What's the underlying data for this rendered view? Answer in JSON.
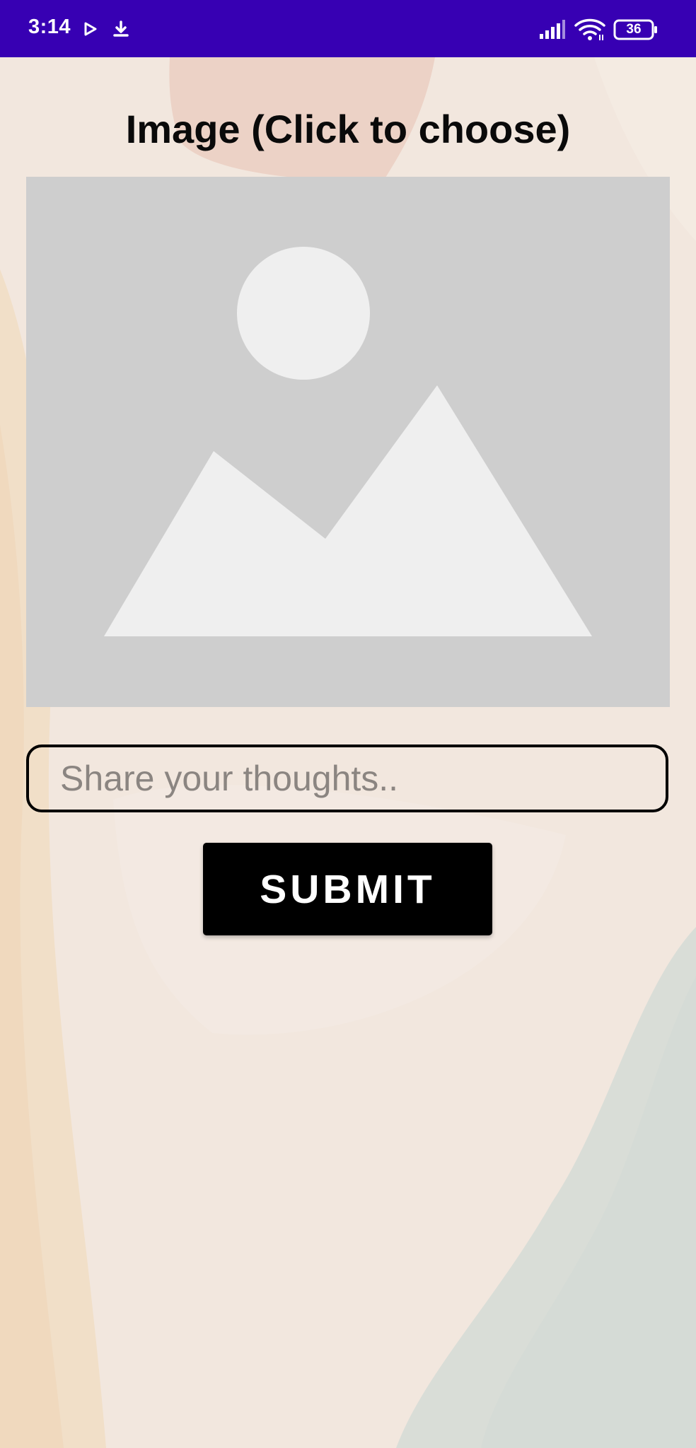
{
  "status_bar": {
    "time": "3:14",
    "battery_level": "36",
    "icons": [
      "play-notification-icon",
      "download-icon",
      "signal-icon",
      "wifi-icon",
      "battery-icon"
    ],
    "background_color": "#3700b3"
  },
  "main": {
    "title": "Image (Click to choose)",
    "image_placeholder_icon": "image-placeholder-icon",
    "thoughts_input": {
      "placeholder": "Share your thoughts..",
      "value": ""
    },
    "submit_label": "SUBMIT"
  },
  "colors": {
    "background": "#f2e7dd",
    "placeholder_box": "#cecece",
    "placeholder_shapes": "#efefef",
    "button": "#000000",
    "accent": "#3700b3"
  }
}
